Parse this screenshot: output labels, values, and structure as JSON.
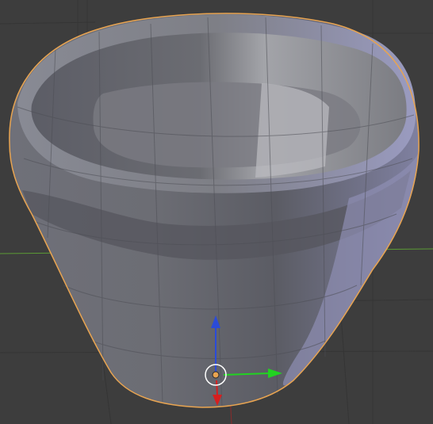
{
  "viewport": {
    "background": "#3d3d3d",
    "grid_color": "#353535",
    "x_axis_color": "#5b9a35",
    "y_axis_color": "#8a2b2b"
  },
  "object": {
    "selected": true,
    "outline_color": "#e8a451",
    "shading": "solid"
  },
  "manipulator": {
    "x_axis_color": "#21d321",
    "y_axis_color": "#d61f1f",
    "z_axis_color": "#2b4bd8",
    "origin_color": "#e8a451"
  }
}
